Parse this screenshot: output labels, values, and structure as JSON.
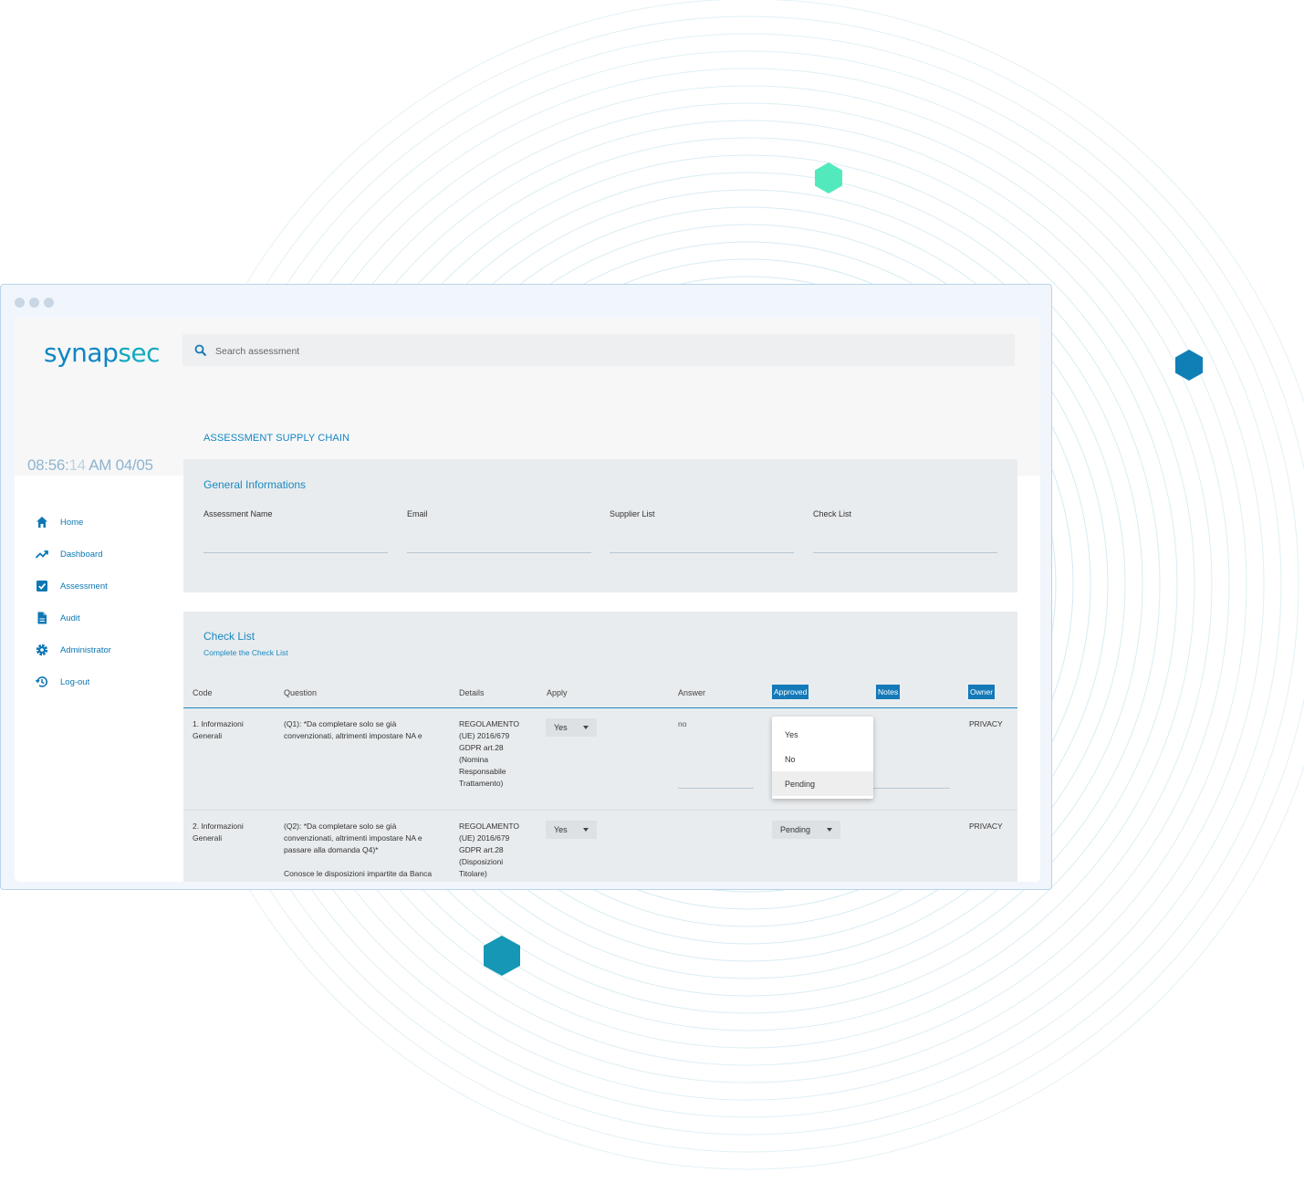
{
  "brand": {
    "logo_part1": "synap",
    "logo_part2": "sec",
    "primary_color": "#0f86c4",
    "accent_color": "#15a9bf"
  },
  "search": {
    "placeholder": "Search assessment",
    "icon": "search-icon"
  },
  "clock": {
    "time_main": "08:56:",
    "time_seconds": "14",
    "time_rest": " AM 04/05"
  },
  "sidebar": {
    "items": [
      {
        "label": "Home",
        "icon": "home-icon"
      },
      {
        "label": "Dashboard",
        "icon": "trending-up-icon"
      },
      {
        "label": "Assessment",
        "icon": "checkbox-icon"
      },
      {
        "label": "Audit",
        "icon": "document-icon"
      },
      {
        "label": "Administrator",
        "icon": "gear-icon"
      },
      {
        "label": "Log-out",
        "icon": "history-icon"
      }
    ]
  },
  "page": {
    "title": "ASSESSMENT SUPPLY CHAIN"
  },
  "general": {
    "title": "General Informations",
    "fields": [
      {
        "label": "Assessment Name",
        "value": ""
      },
      {
        "label": "Email",
        "value": ""
      },
      {
        "label": "Supplier List",
        "value": ""
      },
      {
        "label": "Check List",
        "value": ""
      }
    ]
  },
  "checklist": {
    "title": "Check List",
    "subtitle": "Complete the Check List",
    "columns": {
      "code": "Code",
      "question": "Question",
      "details": "Details",
      "apply": "Apply",
      "answer": "Answer",
      "approved": "Approved",
      "notes": "Notes",
      "owner": "Owner"
    },
    "rows": [
      {
        "code": [
          "1. Informazioni",
          "Generali"
        ],
        "question": [
          "(Q1): *Da completare solo se già",
          "convenzionati, altrimenti impostare NA e"
        ],
        "details": [
          "REGOLAMENTO",
          "(UE) 2016/679",
          "GDPR art.28",
          "(Nomina",
          "Responsabile",
          "Trattamento)"
        ],
        "apply": "Yes",
        "answer": "no",
        "approved": "Pending",
        "owner": "PRIVACY"
      },
      {
        "code": [
          "2. Informazioni",
          "Generali"
        ],
        "question": [
          "(Q2): *Da completare solo se già",
          "convenzionati, altrimenti impostare NA e",
          "passare alla domanda Q4)*",
          "",
          "Conosce le disposizioni impartite da Banca"
        ],
        "details": [
          "REGOLAMENTO",
          "(UE) 2016/679",
          "GDPR art.28",
          "(Disposizioni",
          "Titolare)"
        ],
        "apply": "Yes",
        "answer": "",
        "approved": "Pending",
        "owner": "PRIVACY"
      }
    ],
    "approved_menu": {
      "options": [
        "Yes",
        "No",
        "Pending"
      ],
      "selected": "Pending"
    }
  },
  "decor": {
    "hex_colors": [
      "#3fe8b6",
      "#0f7fb6",
      "#1597b5"
    ],
    "ring_color": "#b9dce8"
  }
}
